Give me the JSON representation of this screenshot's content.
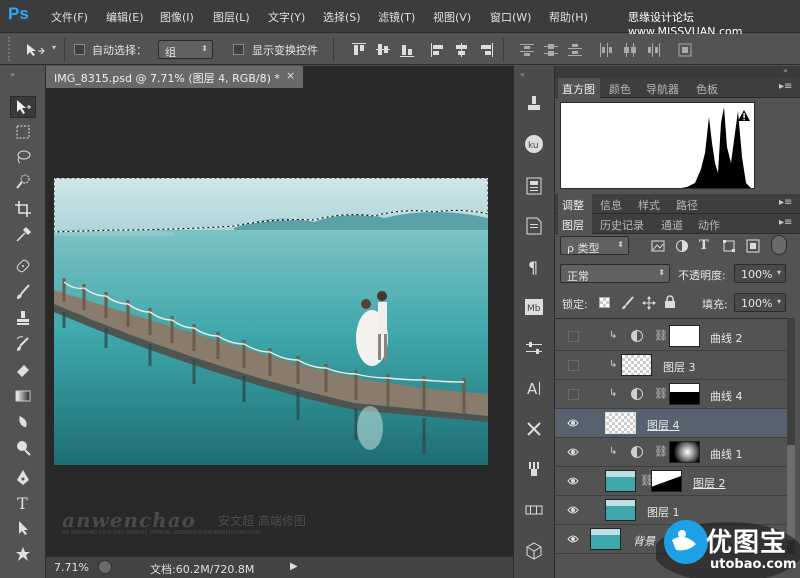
{
  "app": {
    "logo": "Ps"
  },
  "menu": [
    "文件(F)",
    "编辑(E)",
    "图像(I)",
    "图层(L)",
    "文字(Y)",
    "选择(S)",
    "滤镜(T)",
    "视图(V)",
    "窗口(W)",
    "帮助(H)"
  ],
  "top_watermark": "思缘设计论坛 www.MISSVUAN.com",
  "options": {
    "auto_select_label": "自动选择：",
    "auto_select_value": "组",
    "show_transform_label": "显示变换控件"
  },
  "document": {
    "tab_title": "IMG_8315.psd @ 7.71% (图层 4, RGB/8) *",
    "close": "×",
    "zoom": "7.71%",
    "doc_info": "文档:60.2M/720.8M",
    "watermark": "anwenchao",
    "watermark_cn": "安文超 高端修图",
    "watermark_sub": "AN WENCHAO HIGH-END GRAPHIC OFFICIAL WEBSITE/WWW.ANWENCHAO.COM"
  },
  "panels": {
    "top_tabs": [
      "直方图",
      "颜色",
      "导航器",
      "色板"
    ],
    "adj_tabs": [
      "调整",
      "信息",
      "样式",
      "路径"
    ],
    "layer_tabs": [
      "图层",
      "历史记录",
      "通道",
      "动作"
    ],
    "filter_label": "ρ 类型",
    "blend_mode": "正常",
    "opacity_label": "不透明度:",
    "opacity_value": "100%",
    "lock_label": "锁定:",
    "fill_label": "填充:",
    "fill_value": "100%"
  },
  "layers": [
    {
      "name": "曲线 2",
      "visible": false,
      "type": "curves",
      "clipped": true,
      "mask": "white"
    },
    {
      "name": "图层 3",
      "visible": false,
      "type": "pixel",
      "clipped": true
    },
    {
      "name": "曲线 4",
      "visible": false,
      "type": "curves",
      "clipped": true,
      "mask": "hills"
    },
    {
      "name": "图层 4",
      "visible": true,
      "type": "pixel",
      "clipped": false,
      "selected": true
    },
    {
      "name": "曲线 1",
      "visible": true,
      "type": "curves",
      "clipped": true,
      "mask": "dark"
    },
    {
      "name": "图层 2",
      "visible": true,
      "type": "photo-mask",
      "clipped": false
    },
    {
      "name": "图层 1",
      "visible": true,
      "type": "photo",
      "clipped": false
    },
    {
      "name": "背景",
      "visible": true,
      "type": "photo",
      "clipped": false
    }
  ],
  "corner_logo": {
    "cn": "优图宝",
    "url": "utobao.com"
  },
  "colors": {
    "accent": "#31a8ff",
    "selected_row": "#56626e"
  }
}
